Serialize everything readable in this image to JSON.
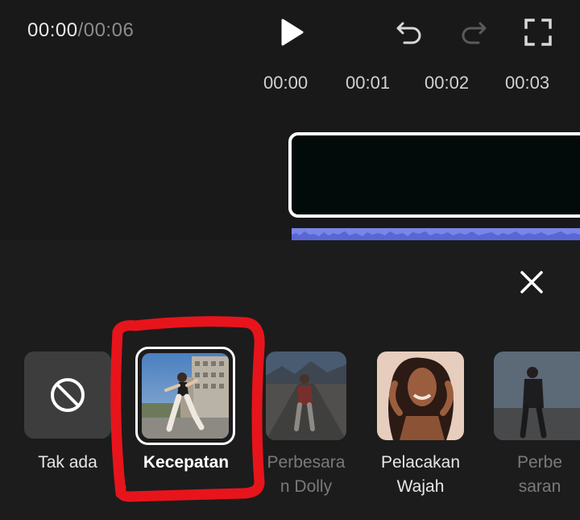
{
  "player": {
    "current_time": "00:00",
    "separator": "/",
    "total_time": "00:06"
  },
  "toolbar": {
    "play": "play-icon",
    "undo": "undo-icon",
    "redo": "redo-icon",
    "fullscreen": "fullscreen-icon"
  },
  "timeline": {
    "ticks": [
      "00:00",
      "00:01",
      "00:02",
      "00:03"
    ],
    "clip_color": "#020a0a",
    "audio_color": "#7a86e8"
  },
  "effects_panel": {
    "close_icon": "close-icon",
    "items": [
      {
        "label": "Tak ada",
        "icon": "none-icon",
        "selected": false,
        "disabled": false
      },
      {
        "label": "Kecepatan",
        "selected": true,
        "disabled": false
      },
      {
        "label": "Perbesaran Dolly",
        "line1": "Perbesara",
        "line2": "n Dolly",
        "selected": false,
        "disabled": true
      },
      {
        "label": "Pelacakan Wajah",
        "line1": "Pelacakan",
        "line2": "Wajah",
        "selected": false,
        "disabled": false
      },
      {
        "label": "Perbesaran",
        "line1": "Perbe",
        "line2": "saran",
        "selected": false,
        "disabled": true
      }
    ]
  },
  "annotation": {
    "color": "#e8141c"
  }
}
